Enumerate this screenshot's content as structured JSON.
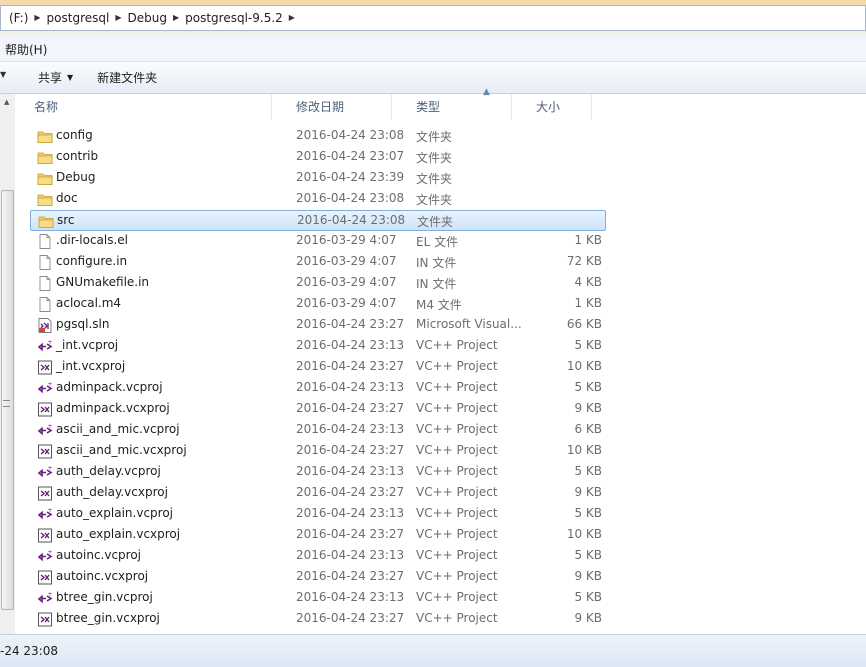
{
  "address": {
    "drive": "(F:)",
    "segments": [
      "postgresql",
      "Debug",
      "postgresql-9.5.2"
    ]
  },
  "menu": {
    "help": "帮助(H)"
  },
  "toolbar": {
    "share": "共享",
    "new_folder": "新建文件夹"
  },
  "columns": {
    "name": "名称",
    "date": "修改日期",
    "type": "类型",
    "size": "大小"
  },
  "files": [
    {
      "name": "config",
      "date": "2016-04-24 23:08",
      "type": "文件夹",
      "size": "",
      "icon": "folder-icon"
    },
    {
      "name": "contrib",
      "date": "2016-04-24 23:07",
      "type": "文件夹",
      "size": "",
      "icon": "folder-icon"
    },
    {
      "name": "Debug",
      "date": "2016-04-24 23:39",
      "type": "文件夹",
      "size": "",
      "icon": "folder-icon"
    },
    {
      "name": "doc",
      "date": "2016-04-24 23:08",
      "type": "文件夹",
      "size": "",
      "icon": "folder-icon"
    },
    {
      "name": "src",
      "date": "2016-04-24 23:08",
      "type": "文件夹",
      "size": "",
      "icon": "folder-icon",
      "selected": true
    },
    {
      "name": ".dir-locals.el",
      "date": "2016-03-29 4:07",
      "type": "EL 文件",
      "size": "1 KB",
      "icon": "file-icon"
    },
    {
      "name": "configure.in",
      "date": "2016-03-29 4:07",
      "type": "IN 文件",
      "size": "72 KB",
      "icon": "file-icon"
    },
    {
      "name": "GNUmakefile.in",
      "date": "2016-03-29 4:07",
      "type": "IN 文件",
      "size": "4 KB",
      "icon": "file-icon"
    },
    {
      "name": "aclocal.m4",
      "date": "2016-03-29 4:07",
      "type": "M4 文件",
      "size": "1 KB",
      "icon": "file-icon"
    },
    {
      "name": "pgsql.sln",
      "date": "2016-04-24 23:27",
      "type": "Microsoft Visual...",
      "size": "66 KB",
      "icon": "solution-icon"
    },
    {
      "name": "_int.vcproj",
      "date": "2016-04-24 23:13",
      "type": "VC++ Project",
      "size": "5 KB",
      "icon": "vcproj-icon"
    },
    {
      "name": "_int.vcxproj",
      "date": "2016-04-24 23:27",
      "type": "VC++ Project",
      "size": "10 KB",
      "icon": "vcxproj-icon"
    },
    {
      "name": "adminpack.vcproj",
      "date": "2016-04-24 23:13",
      "type": "VC++ Project",
      "size": "5 KB",
      "icon": "vcproj-icon"
    },
    {
      "name": "adminpack.vcxproj",
      "date": "2016-04-24 23:27",
      "type": "VC++ Project",
      "size": "9 KB",
      "icon": "vcxproj-icon"
    },
    {
      "name": "ascii_and_mic.vcproj",
      "date": "2016-04-24 23:13",
      "type": "VC++ Project",
      "size": "6 KB",
      "icon": "vcproj-icon"
    },
    {
      "name": "ascii_and_mic.vcxproj",
      "date": "2016-04-24 23:27",
      "type": "VC++ Project",
      "size": "10 KB",
      "icon": "vcxproj-icon"
    },
    {
      "name": "auth_delay.vcproj",
      "date": "2016-04-24 23:13",
      "type": "VC++ Project",
      "size": "5 KB",
      "icon": "vcproj-icon"
    },
    {
      "name": "auth_delay.vcxproj",
      "date": "2016-04-24 23:27",
      "type": "VC++ Project",
      "size": "9 KB",
      "icon": "vcxproj-icon"
    },
    {
      "name": "auto_explain.vcproj",
      "date": "2016-04-24 23:13",
      "type": "VC++ Project",
      "size": "5 KB",
      "icon": "vcproj-icon"
    },
    {
      "name": "auto_explain.vcxproj",
      "date": "2016-04-24 23:27",
      "type": "VC++ Project",
      "size": "10 KB",
      "icon": "vcxproj-icon"
    },
    {
      "name": "autoinc.vcproj",
      "date": "2016-04-24 23:13",
      "type": "VC++ Project",
      "size": "5 KB",
      "icon": "vcproj-icon"
    },
    {
      "name": "autoinc.vcxproj",
      "date": "2016-04-24 23:27",
      "type": "VC++ Project",
      "size": "9 KB",
      "icon": "vcxproj-icon"
    },
    {
      "name": "btree_gin.vcproj",
      "date": "2016-04-24 23:13",
      "type": "VC++ Project",
      "size": "5 KB",
      "icon": "vcproj-icon"
    },
    {
      "name": "btree_gin.vcxproj",
      "date": "2016-04-24 23:27",
      "type": "VC++ Project",
      "size": "9 KB",
      "icon": "vcxproj-icon"
    }
  ],
  "status": {
    "text": "-24 23:08"
  },
  "colors": {
    "selection_border": "#84acdd",
    "selection_fill": "#cde4f9",
    "folder": "#e8c04a",
    "vc_purple": "#68217a"
  }
}
